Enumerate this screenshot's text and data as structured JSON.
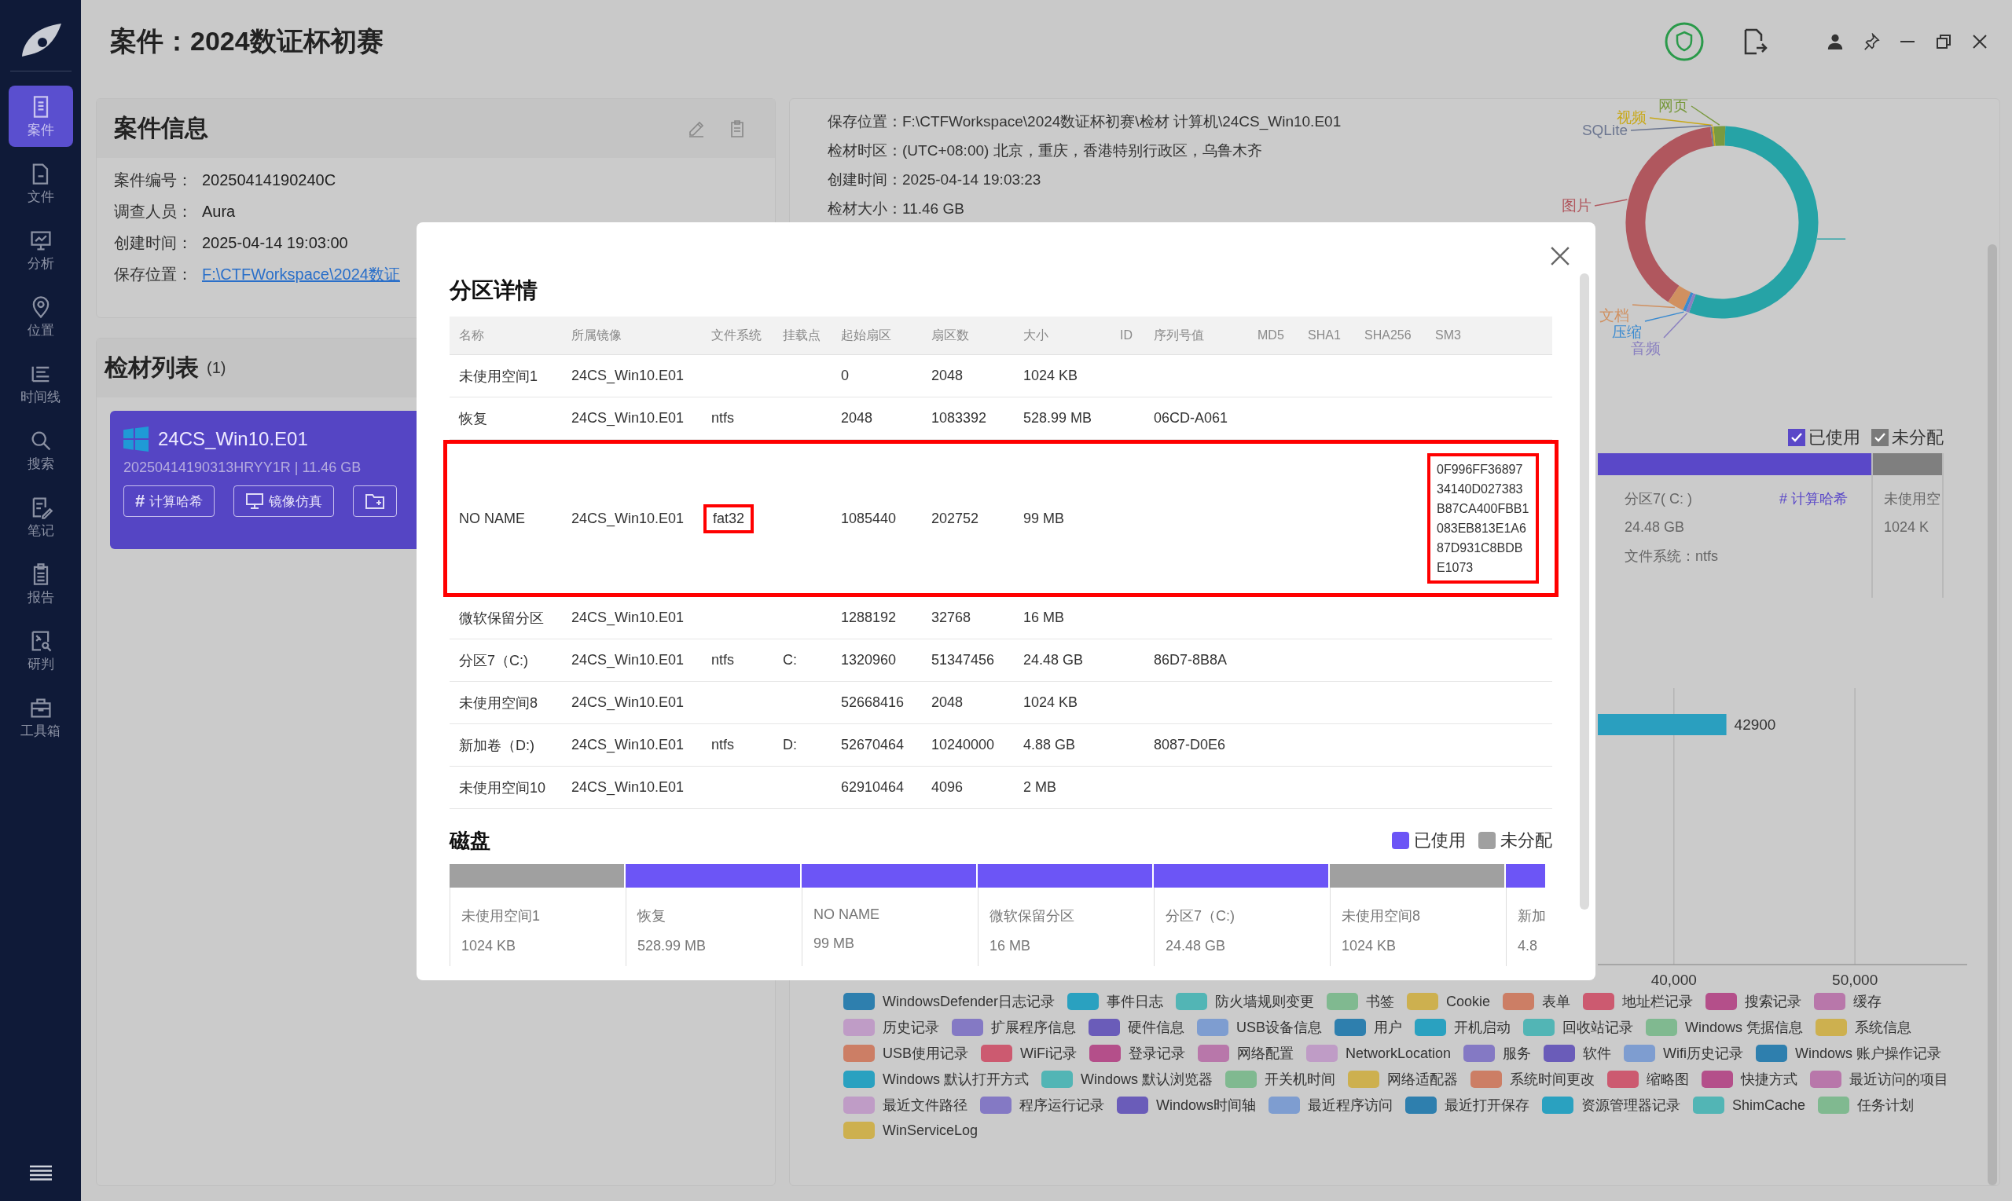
{
  "window": {
    "title": "案件：2024数证杯初赛"
  },
  "sidebar": {
    "items": [
      {
        "label": "案件",
        "selected": true
      },
      {
        "label": "文件",
        "selected": false
      },
      {
        "label": "分析",
        "selected": false
      },
      {
        "label": "位置",
        "selected": false
      },
      {
        "label": "时间线",
        "selected": false
      },
      {
        "label": "搜索",
        "selected": false
      },
      {
        "label": "笔记",
        "selected": false
      },
      {
        "label": "报告",
        "selected": false
      },
      {
        "label": "研判",
        "selected": false
      },
      {
        "label": "工具箱",
        "selected": false
      }
    ]
  },
  "case_info": {
    "title": "案件信息",
    "fields": [
      {
        "label": "案件编号：",
        "value": "20250414190240C",
        "kind": "text"
      },
      {
        "label": "调查人员：",
        "value": "Aura",
        "kind": "text"
      },
      {
        "label": "创建时间：",
        "value": "2025-04-14 19:03:00",
        "kind": "text"
      },
      {
        "label": "保存位置：",
        "value": "F:\\CTFWorkspace\\2024数证",
        "kind": "link"
      }
    ]
  },
  "evidence_list": {
    "title": "检材列表",
    "count": "(1)",
    "items": [
      {
        "name": "24CS_Win10.E01",
        "meta": "20250414190313HRYY1R | 11.46 GB",
        "buttons": [
          {
            "kind": "hash",
            "icon": "#",
            "label": "计算哈希"
          },
          {
            "kind": "emulate",
            "label": "镜像仿真"
          },
          {
            "kind": "folder"
          }
        ]
      }
    ]
  },
  "evidence_details": {
    "fields": [
      {
        "label": "保存位置：",
        "value": "F:\\CTFWorkspace\\2024数证杯初赛\\检材 计算机\\24CS_Win10.E01"
      },
      {
        "label": "检材时区：",
        "value": "(UTC+08:00) 北京，重庆，香港特别行政区，乌鲁木齐"
      },
      {
        "label": "创建时间：",
        "value": "2025-04-14 19:03:23"
      },
      {
        "label": "检材大小：",
        "value": "11.46 GB"
      }
    ]
  },
  "file_types": {
    "labels": [
      {
        "label": "网页",
        "color": "#7a9a40"
      },
      {
        "label": "视频",
        "color": "#c8a818"
      },
      {
        "label": "SQLite",
        "color": "#6c7690"
      },
      {
        "label": "图片",
        "color": "#b0575e"
      },
      {
        "label": "文档",
        "color": "#d09060"
      },
      {
        "label": "压缩",
        "color": "#3a8ad0"
      },
      {
        "label": "音频",
        "color": "#8a80c0"
      }
    ]
  },
  "partition_map": {
    "legend": [
      {
        "label": "已使用",
        "kind": "used",
        "checked": true
      },
      {
        "label": "未分配",
        "kind": "unallocated",
        "checked": true
      }
    ],
    "segments": [
      {
        "name": "分区7( C: )",
        "size": "24.48 GB",
        "file_system": "文件系统：ntfs",
        "action": "# 计算哈希",
        "used": true
      },
      {
        "name": "未使用空",
        "size": "1024 K",
        "used": false
      }
    ]
  },
  "artifact_chart": {
    "chart_data": {
      "type": "bar",
      "orientation": "horizontal",
      "values": [
        42900
      ],
      "xlim": [
        35800,
        56200
      ],
      "xticks": [
        {
          "value": 40000,
          "label": "40,000"
        },
        {
          "value": 50000,
          "label": "50,000"
        }
      ],
      "data_labels": true
    },
    "legend": [
      {
        "label": "WindowsDefender日志记录",
        "color": "#2e7fae"
      },
      {
        "label": "事件日志",
        "color": "#2aa1c0"
      },
      {
        "label": "防火墙规则变更",
        "color": "#52b5b5"
      },
      {
        "label": "书签",
        "color": "#80b990"
      },
      {
        "label": "Cookie",
        "color": "#cdb04f"
      },
      {
        "label": "表单",
        "color": "#cc7e65"
      },
      {
        "label": "地址栏记录",
        "color": "#cc5a70"
      },
      {
        "label": "搜索记录",
        "color": "#b44f8a"
      },
      {
        "label": "缓存",
        "color": "#b877aa"
      },
      {
        "label": "历史记录",
        "color": "#bf9cc6"
      },
      {
        "label": "扩展程序信息",
        "color": "#8479c4"
      },
      {
        "label": "硬件信息",
        "color": "#6a5cb9"
      },
      {
        "label": "USB设备信息",
        "color": "#7e9dd0"
      },
      {
        "label": "用户",
        "color": "#2e7fae"
      },
      {
        "label": "开机启动",
        "color": "#2aa1c0"
      },
      {
        "label": "回收站记录",
        "color": "#52b5b5"
      },
      {
        "label": "Windows 凭据信息",
        "color": "#80b990"
      },
      {
        "label": "系统信息",
        "color": "#cdb04f"
      },
      {
        "label": "USB使用记录",
        "color": "#cc7e65"
      },
      {
        "label": "WiFi记录",
        "color": "#cc5a70"
      },
      {
        "label": "登录记录",
        "color": "#b44f8a"
      },
      {
        "label": "网络配置",
        "color": "#b877aa"
      },
      {
        "label": "NetworkLocation",
        "color": "#bf9cc6"
      },
      {
        "label": "服务",
        "color": "#8479c4"
      },
      {
        "label": "软件",
        "color": "#6a5cb9"
      },
      {
        "label": "Wifi历史记录",
        "color": "#7e9dd0"
      },
      {
        "label": "Windows 账户操作记录",
        "color": "#2e7fae"
      },
      {
        "label": "Windows 默认打开方式",
        "color": "#2aa1c0"
      },
      {
        "label": "Windows 默认浏览器",
        "color": "#52b5b5"
      },
      {
        "label": "开关机时间",
        "color": "#80b990"
      },
      {
        "label": "网络适配器",
        "color": "#cdb04f"
      },
      {
        "label": "系统时间更改",
        "color": "#cc7e65"
      },
      {
        "label": "缩略图",
        "color": "#cc5a70"
      },
      {
        "label": "快捷方式",
        "color": "#b44f8a"
      },
      {
        "label": "最近访问的项目",
        "color": "#b877aa"
      },
      {
        "label": "最近文件路径",
        "color": "#bf9cc6"
      },
      {
        "label": "程序运行记录",
        "color": "#8479c4"
      },
      {
        "label": "Windows时间轴",
        "color": "#6a5cb9"
      },
      {
        "label": "最近程序访问",
        "color": "#7e9dd0"
      },
      {
        "label": "最近打开保存",
        "color": "#2e7fae"
      },
      {
        "label": "资源管理器记录",
        "color": "#2aa1c0"
      },
      {
        "label": "ShimCache",
        "color": "#52b5b5"
      },
      {
        "label": "任务计划",
        "color": "#80b990"
      },
      {
        "label": "WinServiceLog",
        "color": "#cdb04f"
      }
    ]
  },
  "modal": {
    "title": "分区详情",
    "columns": [
      "名称",
      "所属镜像",
      "文件系统",
      "挂载点",
      "起始扇区",
      "扇区数",
      "大小",
      "ID",
      "序列号值",
      "MD5",
      "SHA1",
      "SHA256",
      "SM3"
    ],
    "rows": [
      {
        "name": "未使用空间1",
        "image": "24CS_Win10.E01",
        "start": "0",
        "sectors": "2048",
        "size": "1024 KB",
        "highlighted": false
      },
      {
        "name": "恢复",
        "image": "24CS_Win10.E01",
        "fs": "ntfs",
        "start": "2048",
        "sectors": "1083392",
        "size": "528.99 MB",
        "serial": "06CD-A061",
        "highlighted": false
      },
      {
        "name": "NO NAME",
        "image": "24CS_Win10.E01",
        "fs": "fat32",
        "start": "1085440",
        "sectors": "202752",
        "size": "99 MB",
        "sm3": "0F996FF3689734140D027383B87CA400FBB1083EB813E1A687D931C8BDBE1073",
        "highlighted": true,
        "fs_boxed": true,
        "sm3_boxed": true
      },
      {
        "name": "微软保留分区",
        "image": "24CS_Win10.E01",
        "start": "1288192",
        "sectors": "32768",
        "size": "16 MB",
        "highlighted": false
      },
      {
        "name": "分区7（C:)",
        "image": "24CS_Win10.E01",
        "fs": "ntfs",
        "mount": "C:",
        "start": "1320960",
        "sectors": "51347456",
        "size": "24.48 GB",
        "serial": "86D7-8B8A",
        "highlighted": false
      },
      {
        "name": "未使用空间8",
        "image": "24CS_Win10.E01",
        "start": "52668416",
        "sectors": "2048",
        "size": "1024 KB",
        "highlighted": false
      },
      {
        "name": "新加卷（D:)",
        "image": "24CS_Win10.E01",
        "fs": "ntfs",
        "mount": "D:",
        "start": "52670464",
        "sectors": "10240000",
        "size": "4.88 GB",
        "serial": "8087-D0E6",
        "highlighted": false
      },
      {
        "name": "未使用空间10",
        "image": "24CS_Win10.E01",
        "start": "62910464",
        "sectors": "4096",
        "size": "2 MB",
        "highlighted": false
      }
    ],
    "disk": {
      "title": "磁盘",
      "legend": [
        {
          "label": "已使用",
          "kind": "used"
        },
        {
          "label": "未分配",
          "kind": "unallocated"
        }
      ],
      "segments": [
        {
          "name": "未使用空间1",
          "size": "1024 KB",
          "used": false
        },
        {
          "name": "恢复",
          "size": "528.99 MB",
          "used": true
        },
        {
          "name": "NO NAME",
          "size": "99 MB",
          "used": true
        },
        {
          "name": "微软保留分区",
          "size": "16 MB",
          "used": true
        },
        {
          "name": "分区7（C:)",
          "size": "24.48 GB",
          "used": true
        },
        {
          "name": "未使用空间8",
          "size": "1024 KB",
          "used": false
        },
        {
          "name": "新加",
          "size": "4.8",
          "used": true
        }
      ]
    }
  }
}
